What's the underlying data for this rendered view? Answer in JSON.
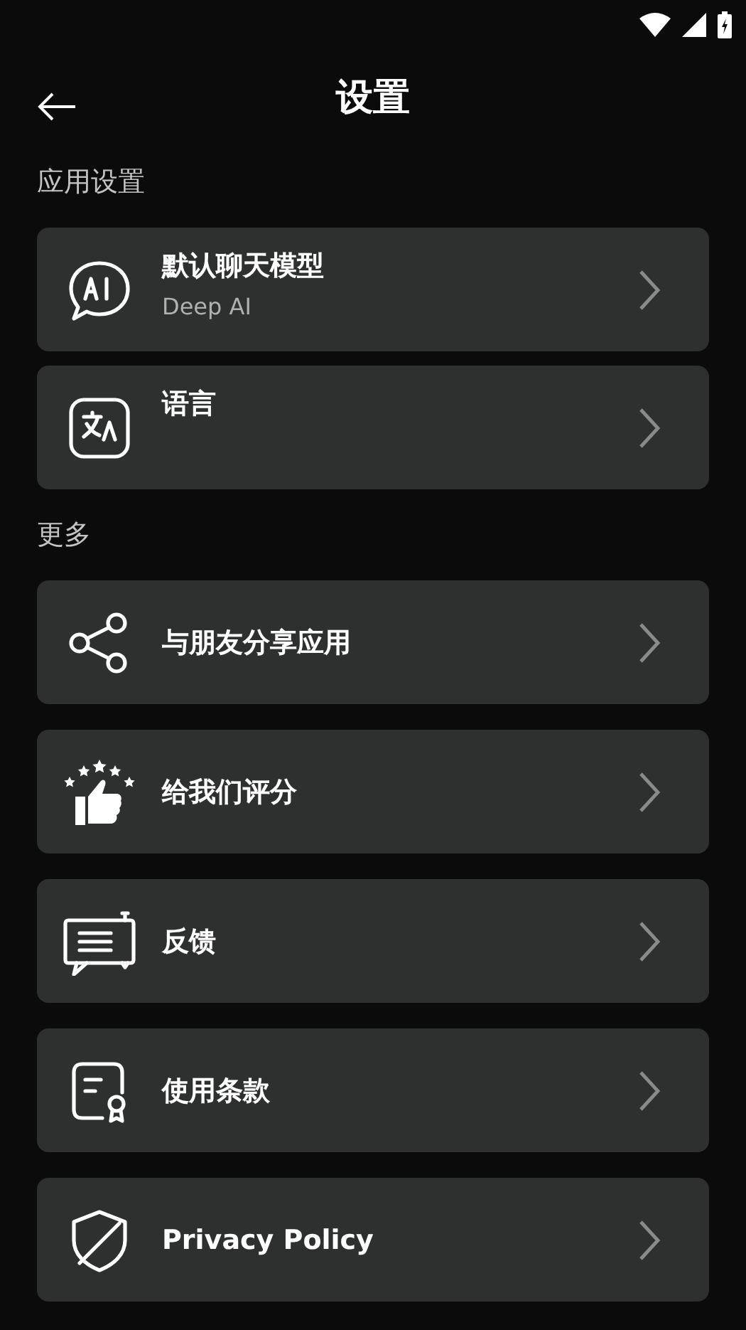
{
  "header": {
    "title": "设置"
  },
  "sections": [
    {
      "title": "应用设置",
      "items": [
        {
          "title": "默认聊天模型",
          "subtitle": "Deep AI"
        },
        {
          "title": "语言"
        }
      ]
    },
    {
      "title": "更多",
      "items": [
        {
          "title": "与朋友分享应用"
        },
        {
          "title": "给我们评分"
        },
        {
          "title": "反馈"
        },
        {
          "title": "使用条款"
        },
        {
          "title": "Privacy Policy"
        }
      ]
    }
  ]
}
